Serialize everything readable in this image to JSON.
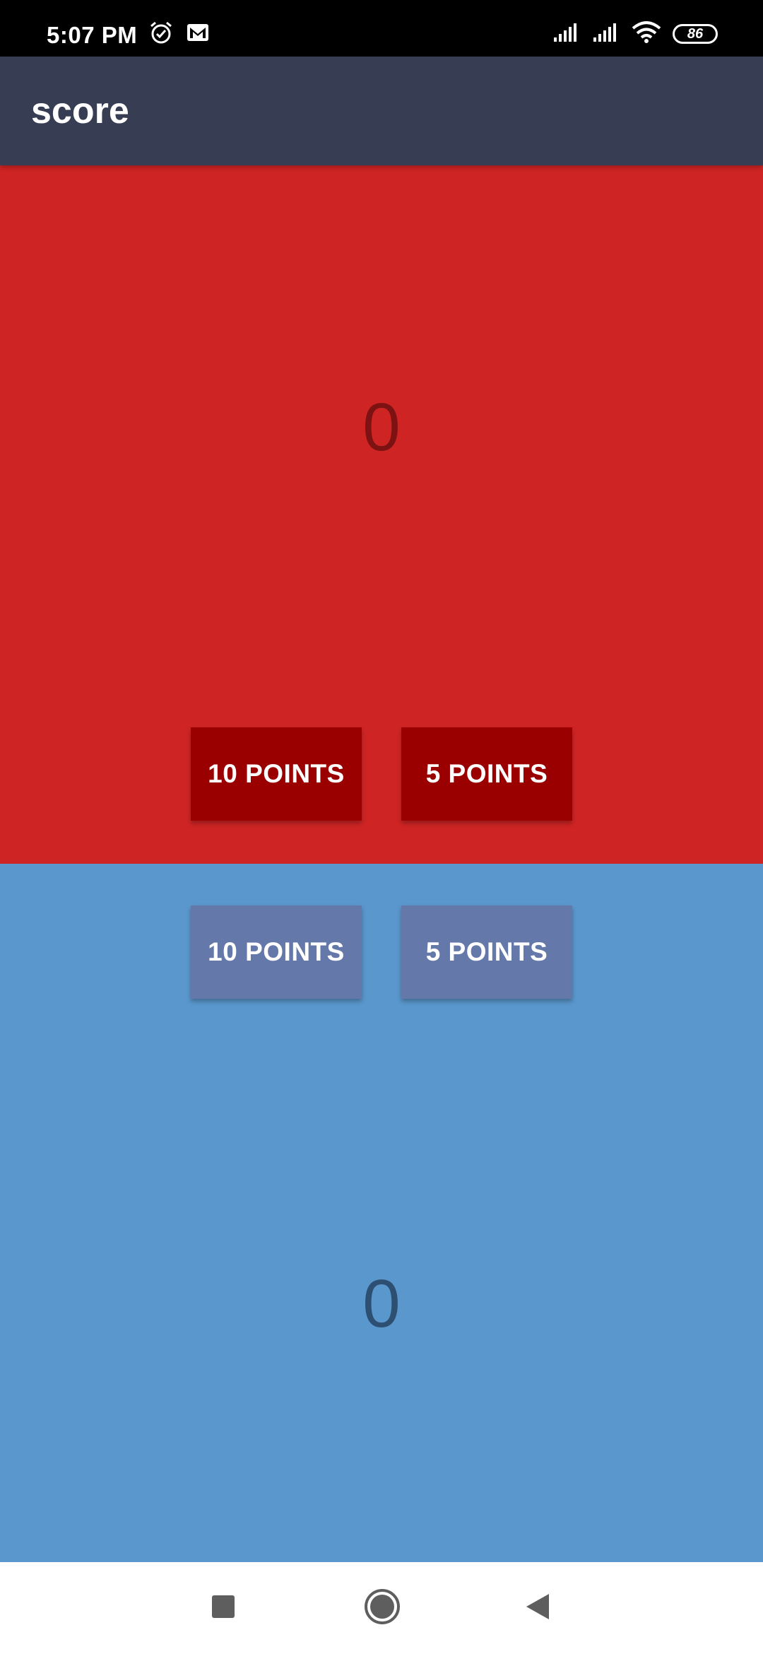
{
  "status_bar": {
    "time": "5:07 PM",
    "battery": "86",
    "left_icons": [
      "alarm-icon",
      "gmail-icon"
    ],
    "right_icons": [
      "signal-icon",
      "signal-icon",
      "wifi-icon",
      "battery-icon"
    ]
  },
  "app_bar": {
    "title": "score"
  },
  "team_a": {
    "score": "0",
    "buttons": {
      "ten": "10 POINTS",
      "five": "5 POINTS"
    },
    "color": "#cf2424",
    "button_color": "#9a0000"
  },
  "team_b": {
    "score": "0",
    "buttons": {
      "ten": "10 POINTS",
      "five": "5 POINTS"
    },
    "color": "#5a97cd",
    "button_color": "#6479a9"
  },
  "nav_bar": {
    "icons": [
      "recent-apps-icon",
      "home-icon",
      "back-icon"
    ]
  }
}
